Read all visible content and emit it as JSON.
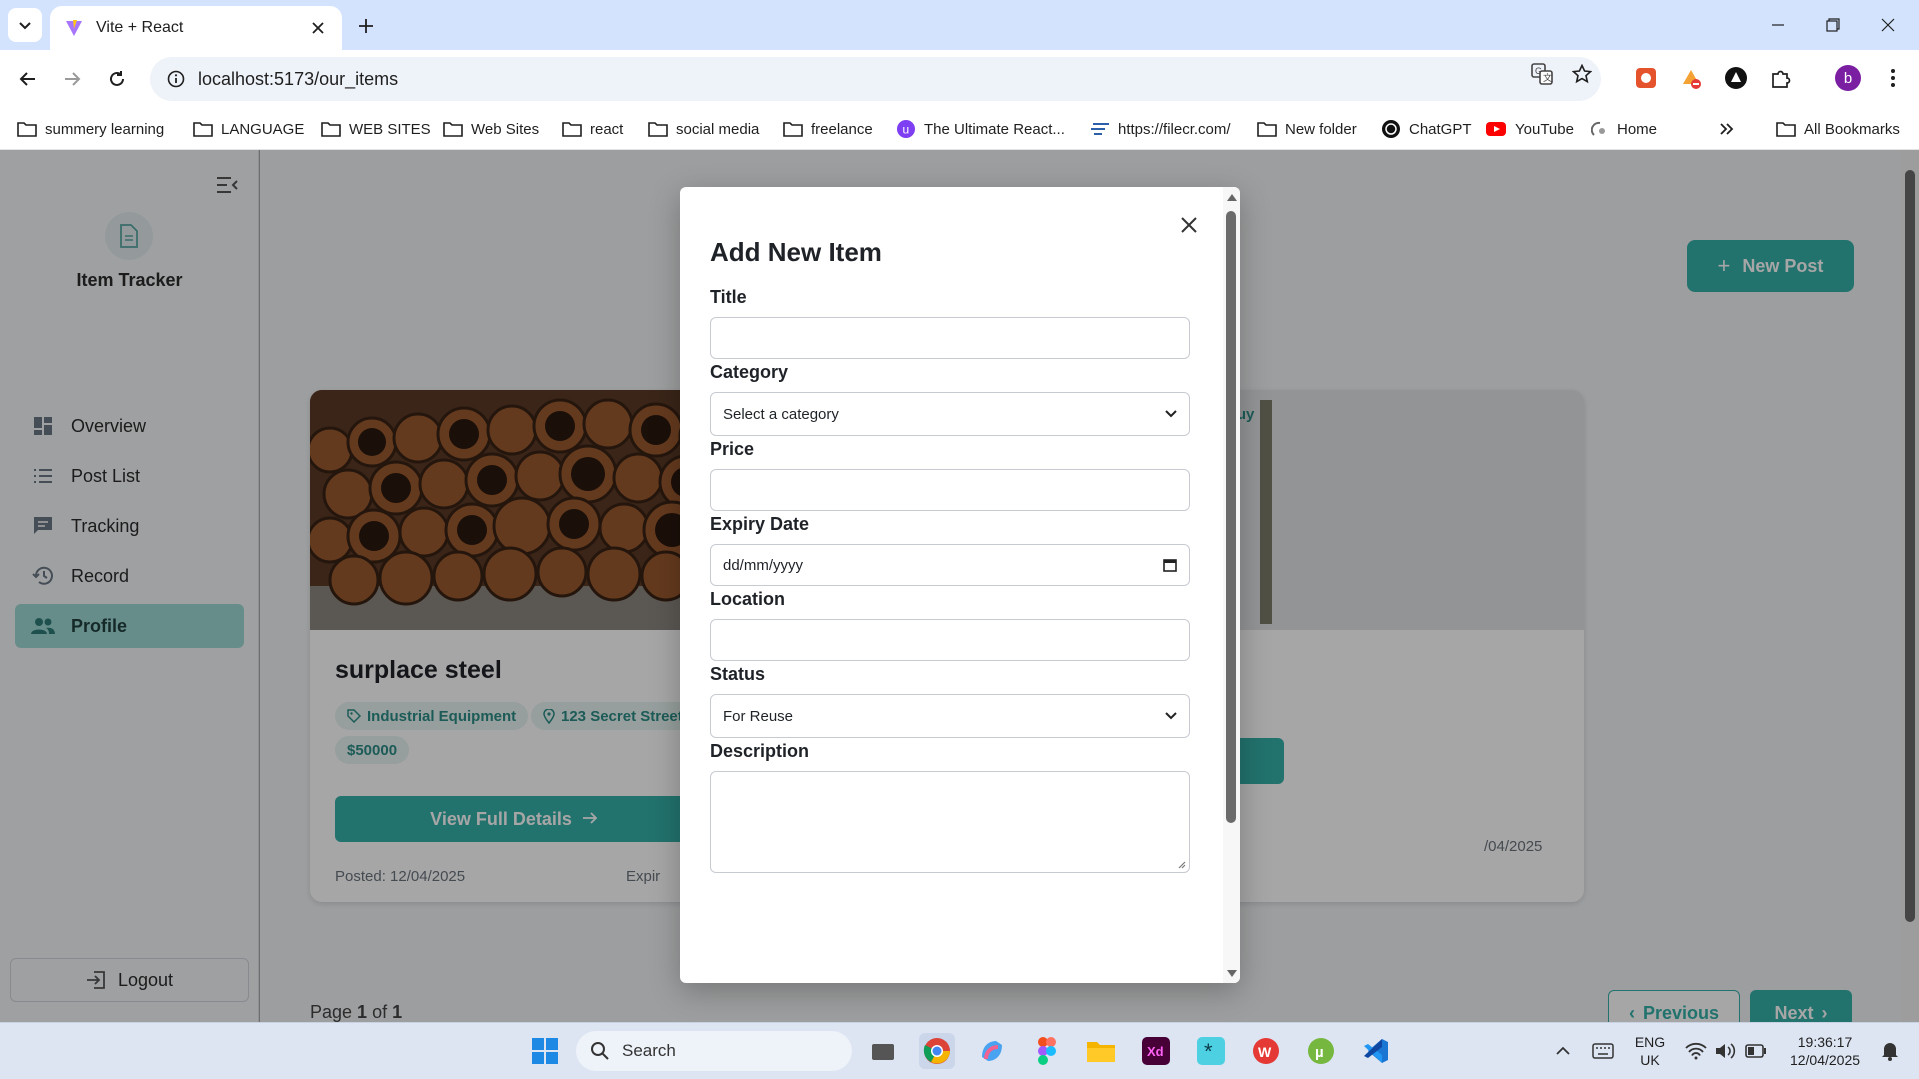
{
  "browser": {
    "tab_title": "Vite + React",
    "url": "localhost:5173/our_items",
    "profile_initial": "b",
    "bookmarks": [
      "summery learning",
      "LANGUAGE",
      "WEB SITES",
      "Web Sites",
      "react",
      "social media",
      "freelance",
      "The Ultimate React...",
      "https://filecr.com/",
      "New folder",
      "ChatGPT",
      "YouTube",
      "Home"
    ],
    "all_bookmarks": "All Bookmarks"
  },
  "sidebar": {
    "app_name": "Item Tracker",
    "items": [
      {
        "label": "Overview",
        "icon": "dashboard-icon"
      },
      {
        "label": "Post List",
        "icon": "list-icon"
      },
      {
        "label": "Tracking",
        "icon": "chat-icon"
      },
      {
        "label": "Record",
        "icon": "history-icon"
      },
      {
        "label": "Profile",
        "icon": "people-icon",
        "active": true
      }
    ],
    "logout_label": "Logout"
  },
  "main": {
    "new_post_label": "New Post",
    "cards": [
      {
        "title": "surplace steel",
        "category": "Industrial Equipment",
        "location": "123 Secret Street,",
        "price": "$50000",
        "button": "View Full Details",
        "posted": "Posted: 12/04/2025",
        "expiry": "Expir"
      },
      {
        "status_badge": "ed to Buy",
        "expiry_tail": "/04/2025"
      }
    ],
    "pagination": {
      "page_text_prefix": "Page ",
      "current": "1",
      "of_text": " of ",
      "total": "1",
      "previous": "Previous",
      "next": "Next"
    }
  },
  "modal": {
    "title": "Add New Item",
    "fields": {
      "title_label": "Title",
      "category_label": "Category",
      "category_value": "Select a category",
      "price_label": "Price",
      "expiry_label": "Expiry Date",
      "expiry_placeholder": "dd/mm/yyyy",
      "location_label": "Location",
      "status_label": "Status",
      "status_value": "For Reuse",
      "description_label": "Description"
    }
  },
  "taskbar": {
    "search_label": "Search",
    "lang_line1": "ENG",
    "lang_line2": "UK",
    "time": "19:36:17",
    "date": "12/04/2025"
  },
  "colors": {
    "accent": "#35b0a8",
    "accent_light": "#9fd9d5",
    "tag_bg": "#e7f4f2",
    "chrome_blue": "#d3e3fd"
  }
}
